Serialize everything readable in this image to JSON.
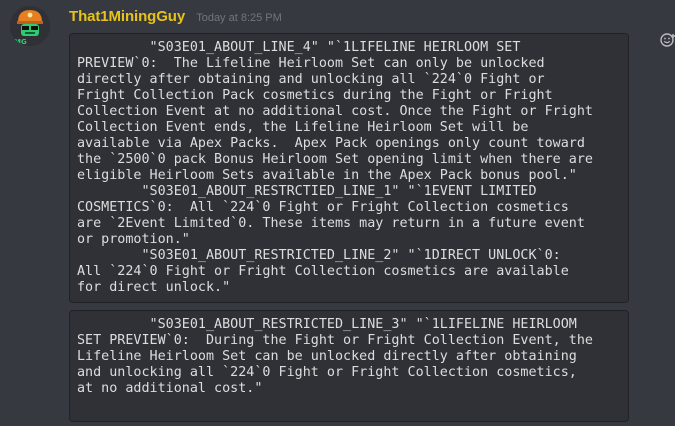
{
  "message": {
    "author": "That1MiningGuy",
    "timestamp": "Today at 8:25 PM",
    "code_blocks": [
      "         \"S03E01_ABOUT_LINE_4\" \"`1LIFELINE HEIRLOOM SET\nPREVIEW`0:  The Lifeline Heirloom Set can only be unlocked\ndirectly after obtaining and unlocking all `224`0 Fight or\nFright Collection Pack cosmetics during the Fight or Fright\nCollection Event at no additional cost. Once the Fight or Fright\nCollection Event ends, the Lifeline Heirloom Set will be\navailable via Apex Packs.  Apex Pack openings only count toward\nthe `2500`0 pack Bonus Heirloom Set opening limit when there are\neligible Heirloom Sets available in the Apex Pack bonus pool.\"\n        \"S03E01_ABOUT_RESTRCTIED_LINE_1\" \"`1EVENT LIMITED\nCOSMETICS`0:  All `224`0 Fight or Fright Collection cosmetics\nare `2Event Limited`0. These items may return in a future event\nor promotion.\"\n        \"S03E01_ABOUT_RESTRICTED_LINE_2\" \"`1DIRECT UNLOCK`0:\nAll `224`0 Fight or Fright Collection cosmetics are available\nfor direct unlock.\"",
      "         \"S03E01_ABOUT_RESTRICTED_LINE_3\" \"`1LIFELINE HEIRLOOM\nSET PREVIEW`0:  During the Fight or Fright Collection Event, the\nLifeline Heirloom Set can be unlocked directly after obtaining\nand unlocking all `224`0 Fight or Fright Collection cosmetics,\nat no additional cost.\""
    ]
  },
  "colors": {
    "background": "#36393f",
    "code_background": "#2f3136",
    "author_name": "#e8c21c",
    "timestamp": "#72767d",
    "code_text": "#dcddde"
  },
  "icons": {
    "avatar": "avatar-icon",
    "add_reaction": "add-reaction-icon"
  }
}
